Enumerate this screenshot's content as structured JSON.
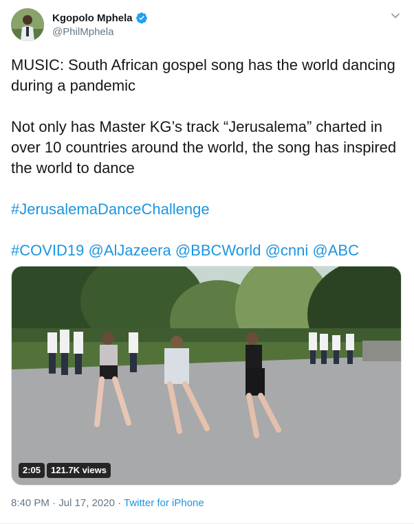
{
  "author": {
    "name": "Kgopolo Mphela",
    "handle": "@PhilMphela",
    "verified": true
  },
  "tweet": {
    "paragraph1": "MUSIC: South African gospel song has the world dancing during a pandemic",
    "paragraph2": "Not only has Master KG’s track “Jerusalema” charted in over 10 countries around the world, the song has inspired the world to dance",
    "hashtag_challenge": "#JerusalemaDanceChallenge",
    "tags": [
      "#COVID19",
      "@AlJazeera",
      "@BBCWorld",
      "@cnni",
      "@ABC"
    ]
  },
  "media": {
    "duration": "2:05",
    "views": "121.7K views"
  },
  "meta": {
    "time": "8:40 PM",
    "separator1": " · ",
    "date": "Jul 17, 2020",
    "separator2": " · ",
    "source": "Twitter for iPhone"
  },
  "colors": {
    "link": "#1b95e0",
    "verified": "#1da1f2",
    "muted": "#657786"
  },
  "icons": {
    "verified": "verified-badge-icon",
    "caret": "chevron-down-icon"
  }
}
